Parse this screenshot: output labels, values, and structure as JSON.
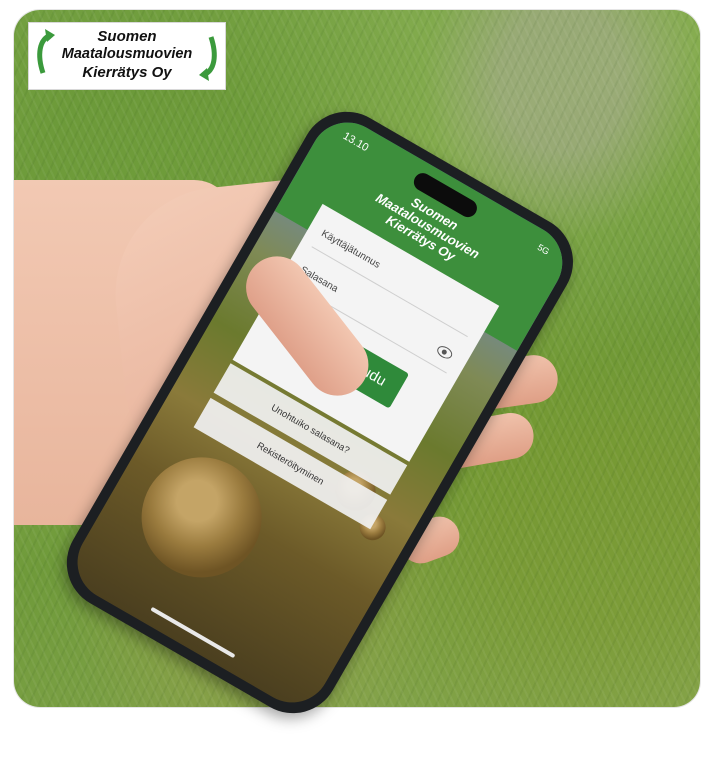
{
  "overlay_logo": {
    "line1": "Suomen",
    "line2": "Maatalousmuovien",
    "line3": "Kierrätys Oy",
    "arrow_color": "#3b9a3c"
  },
  "phone": {
    "status_time": "13.10",
    "status_network": "5G",
    "header_logo": {
      "line1": "Suomen",
      "line2": "Maatalousmuovien",
      "line3": "Kierrätys Oy"
    },
    "username_placeholder": "Käyttäjätunnus",
    "password_placeholder": "Salasana",
    "login_button": "Kirjaudu",
    "forgot_password_link": "Unohtuiko salasana?",
    "register_link": "Rekisteröityminen",
    "brand_green": "#3d8f3c"
  }
}
